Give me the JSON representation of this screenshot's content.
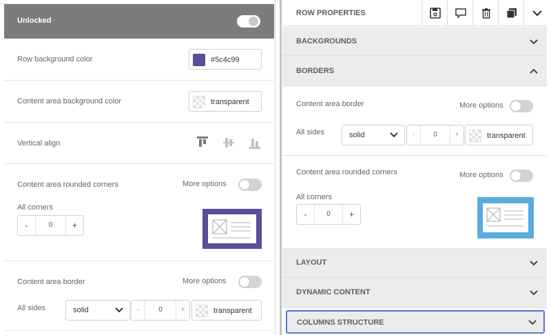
{
  "left": {
    "lock_label": "Unlocked",
    "row_bg_label": "Row background color",
    "row_bg_value": "#5c4c99",
    "row_bg_swatch": "#5c4c99",
    "content_bg_label": "Content area background color",
    "content_bg_value": "transparent",
    "valign_label": "Vertical align",
    "corners_label": "Content area rounded corners",
    "corners_more": "More options",
    "all_corners_label": "All corners",
    "corners_value": "0",
    "minus": "-",
    "plus": "+",
    "border_label": "Content area border",
    "border_more": "More options",
    "all_sides_label": "All sides",
    "border_style": "solid",
    "border_width": "0",
    "border_color": "transparent",
    "preview_color": "#5c4c99"
  },
  "right": {
    "title": "ROW PROPERTIES",
    "toolbar_icons": [
      "save-icon",
      "comment-icon",
      "trash-icon",
      "duplicate-icon",
      "chevron-down-icon"
    ],
    "backgrounds": "BACKGROUNDS",
    "borders": "BORDERS",
    "border_label": "Content area border",
    "border_more": "More options",
    "all_sides_label": "All sides",
    "border_style": "solid",
    "border_width": "0",
    "border_color": "transparent",
    "corners_label": "Content area rounded corners",
    "corners_more": "More options",
    "all_corners_label": "All corners",
    "corners_value": "0",
    "minus": "-",
    "plus": "+",
    "layout": "LAYOUT",
    "dynamic": "DYNAMIC CONTENT",
    "columns": "COLUMNS STRUCTURE",
    "preview_color": "#5aabdf"
  }
}
